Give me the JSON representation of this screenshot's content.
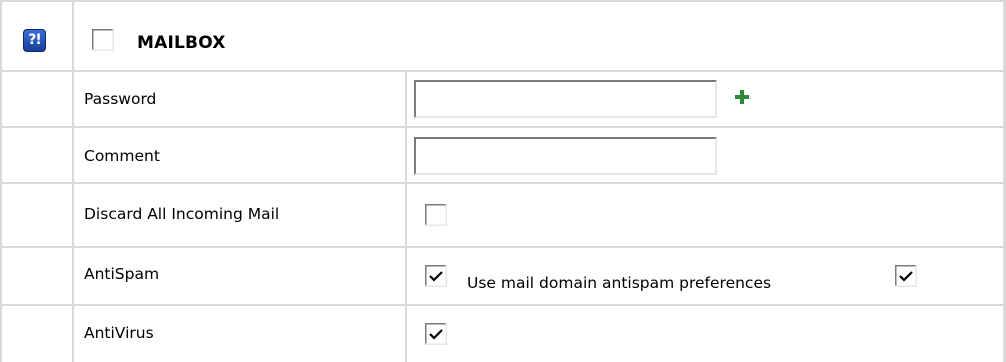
{
  "section": {
    "help_icon_text": "?!",
    "title": "MAILBOX",
    "header_checked": false
  },
  "rows": [
    {
      "label": "Password",
      "type": "password",
      "value": ""
    },
    {
      "label": "Comment",
      "type": "text",
      "value": ""
    },
    {
      "label": "Discard All Incoming Mail",
      "type": "checkbox",
      "checked": false
    },
    {
      "label": "AntiSpam",
      "type": "checkbox",
      "checked": true,
      "secondary_label": "Use mail domain antispam preferences",
      "secondary_checked": true
    },
    {
      "label": "AntiVirus",
      "type": "checkbox",
      "checked": true
    }
  ],
  "icons": {
    "help": "help-icon",
    "add": "plus-icon",
    "add_color": "#2e8b3a"
  },
  "colors": {
    "grid": "#d9d9d9",
    "help_icon_bg": "#2550b8",
    "checkbox_border_dark": "#7a7a7a"
  }
}
